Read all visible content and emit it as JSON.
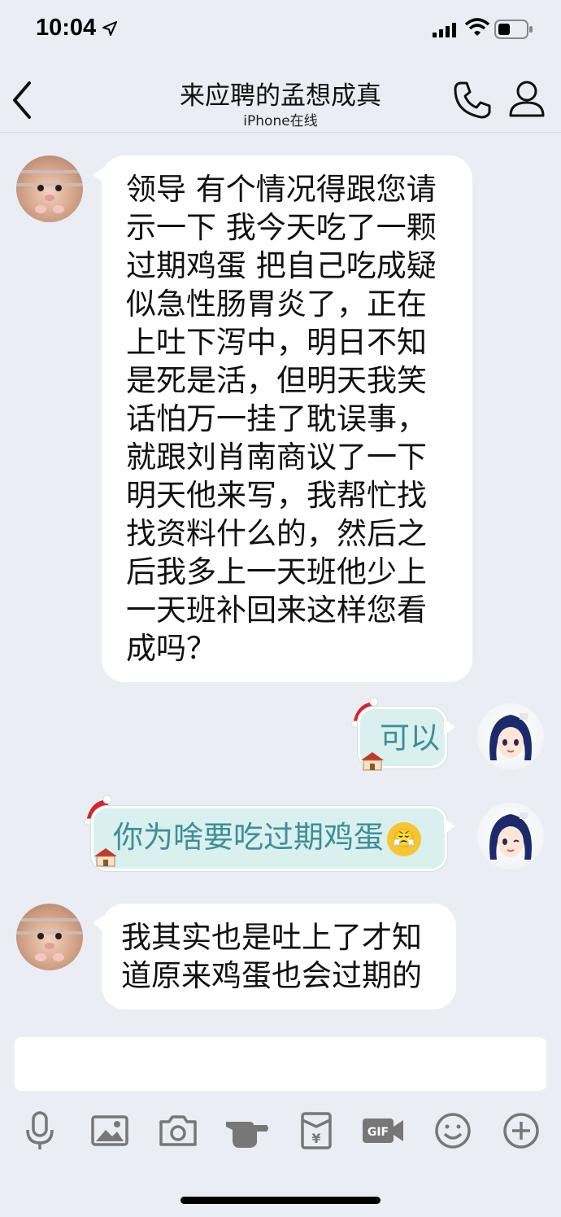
{
  "status_bar": {
    "time": "10:04"
  },
  "header": {
    "title": "来应聘的孟想成真",
    "subtitle": "iPhone在线"
  },
  "messages": [
    {
      "side": "left",
      "lines": [
        "领导 有个情况得跟您请",
        "示一下 我今天吃了一颗",
        "过期鸡蛋 把自己吃成疑",
        "似急性肠胃炎了，正在",
        "上吐下泻中，明日不知",
        "是死是活，但明天我笑",
        "话怕万一挂了耽误事，",
        "就跟刘肖南商议了一下",
        "明天他来写，我帮忙找",
        "找资料什么的，然后之",
        "后我多上一天班他少上",
        "一天班补回来这样您看",
        "成吗？"
      ]
    },
    {
      "side": "right",
      "text": "可以"
    },
    {
      "side": "right",
      "text": "你为啥要吃过期鸡蛋",
      "emoji": "😤"
    },
    {
      "side": "left",
      "lines": [
        "我其实也是吐上了才知",
        "道原来鸡蛋也会过期的"
      ]
    }
  ],
  "input": {
    "placeholder": ""
  },
  "toolbar": [
    "mic-icon",
    "image-icon",
    "camera-icon",
    "poke-icon",
    "red-packet-icon",
    "gif-icon",
    "emoji-icon",
    "plus-icon"
  ],
  "colors": {
    "background": "#ebedf4",
    "bubble_right": "#d9f0ee",
    "bubble_right_text": "#3c8f98",
    "bubble_left": "#ffffff"
  }
}
